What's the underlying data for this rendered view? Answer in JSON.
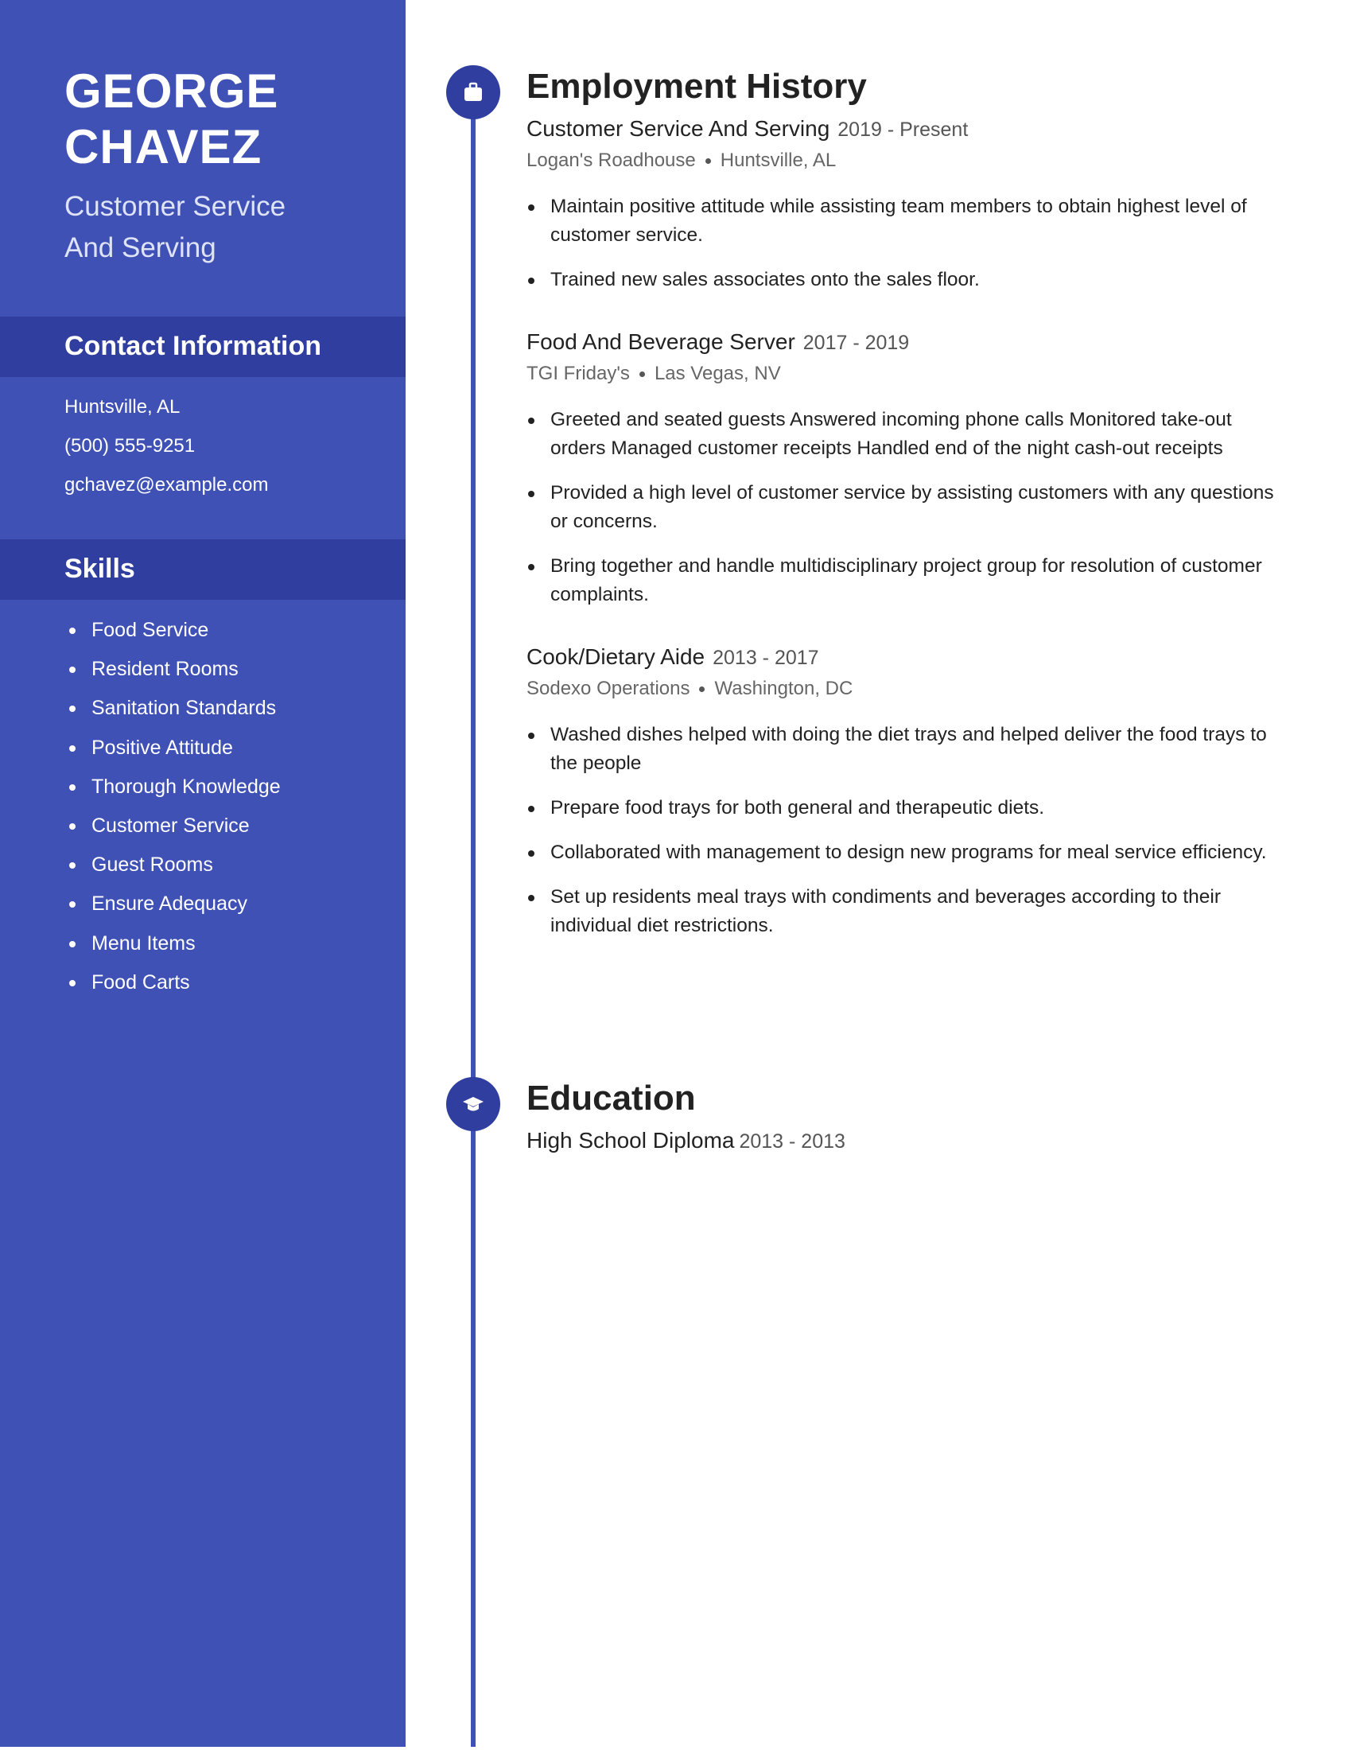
{
  "profile": {
    "first_name": "GEORGE",
    "last_name": "CHAVEZ",
    "title_line1": "Customer Service",
    "title_line2": "And Serving"
  },
  "contact": {
    "heading": "Contact Information",
    "location": "Huntsville, AL",
    "phone": "(500) 555-9251",
    "email": "gchavez@example.com"
  },
  "skills": {
    "heading": "Skills",
    "items": [
      "Food Service",
      "Resident Rooms",
      "Sanitation Standards",
      "Positive Attitude",
      "Thorough Knowledge",
      "Customer Service",
      "Guest Rooms",
      "Ensure Adequacy",
      "Menu Items",
      "Food Carts"
    ]
  },
  "employment": {
    "heading": "Employment History",
    "icon": "briefcase-icon",
    "jobs": [
      {
        "title": "Customer Service And Serving",
        "dates": "2019 - Present",
        "company": "Logan's Roadhouse",
        "location": "Huntsville, AL",
        "bullets": [
          "Maintain positive attitude while assisting team members to obtain highest level of customer service.",
          "Trained new sales associates onto the sales floor."
        ]
      },
      {
        "title": "Food And Beverage Server",
        "dates": "2017 - 2019",
        "company": "TGI Friday's",
        "location": "Las Vegas, NV",
        "bullets": [
          "Greeted and seated guests Answered incoming phone calls Monitored take-out orders Managed customer receipts Handled end of the night cash-out receipts",
          "Provided a high level of customer service by assisting customers with any questions or concerns.",
          "Bring together and handle multidisciplinary project group for resolution of customer complaints."
        ]
      },
      {
        "title": "Cook/Dietary Aide",
        "dates": "2013 - 2017",
        "company": "Sodexo Operations",
        "location": "Washington, DC",
        "bullets": [
          "Washed dishes helped with doing the diet trays and helped deliver the food trays to the people",
          "Prepare food trays for both general and therapeutic diets.",
          "Collaborated with management to design new programs for meal service efficiency.",
          "Set up residents meal trays with condiments and beverages according to their individual diet restrictions."
        ]
      }
    ]
  },
  "education": {
    "heading": "Education",
    "icon": "graduation-cap-icon",
    "degree": "High School Diploma",
    "dates": "2013 - 2013"
  },
  "colors": {
    "sidebar": "#3f51b5",
    "band": "#303f9f",
    "text": "#222222"
  }
}
